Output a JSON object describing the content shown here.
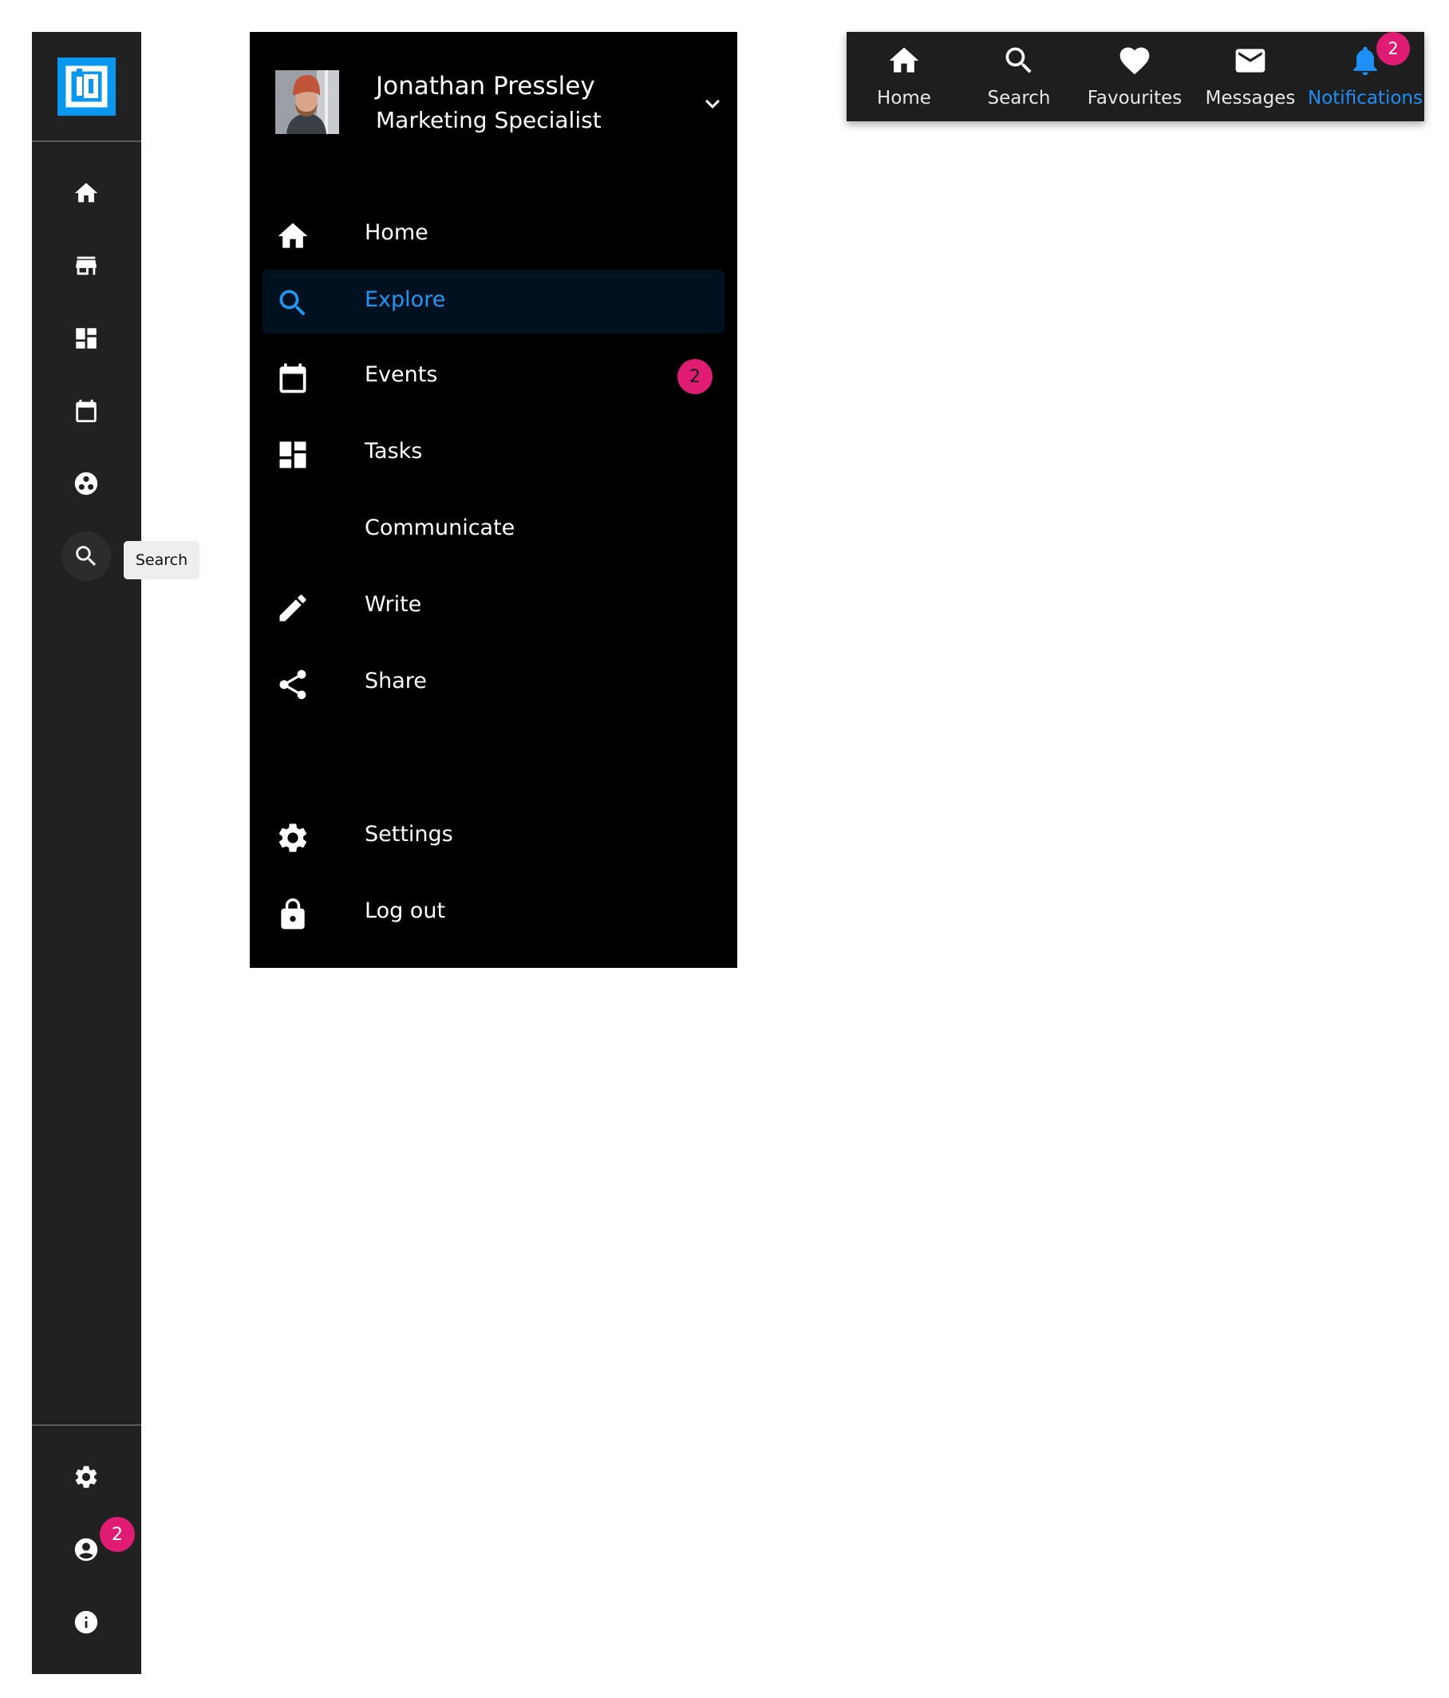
{
  "rail": {
    "logo": "brand-logo",
    "items": [
      {
        "icon": "home-icon"
      },
      {
        "icon": "store-icon"
      },
      {
        "icon": "dashboard-icon"
      },
      {
        "icon": "calendar-icon"
      },
      {
        "icon": "community-icon"
      },
      {
        "icon": "search-icon",
        "active": true
      }
    ],
    "bottom_items": [
      {
        "icon": "gear-icon"
      },
      {
        "icon": "account-icon",
        "badge": "2"
      },
      {
        "icon": "info-icon"
      }
    ],
    "tooltip": "Search"
  },
  "drawer": {
    "user": {
      "name": "Jonathan Pressley",
      "title": "Marketing Specialist"
    },
    "items": [
      {
        "label": "Home",
        "icon": "home-icon"
      },
      {
        "label": "Explore",
        "icon": "search-icon",
        "active": true
      },
      {
        "label": "Events",
        "icon": "calendar-icon",
        "badge": "2"
      },
      {
        "label": "Tasks",
        "icon": "dashboard-icon"
      },
      {
        "label": "Communicate",
        "icon": ""
      },
      {
        "label": "Write",
        "icon": "pencil-icon"
      },
      {
        "label": "Share",
        "icon": "share-icon"
      }
    ],
    "footer_items": [
      {
        "label": "Settings",
        "icon": "gear-icon"
      },
      {
        "label": "Log out",
        "icon": "lock-icon"
      }
    ]
  },
  "bottom_nav": {
    "items": [
      {
        "label": "Home",
        "icon": "home-icon"
      },
      {
        "label": "Search",
        "icon": "search-icon"
      },
      {
        "label": "Favourites",
        "icon": "heart-icon"
      },
      {
        "label": "Messages",
        "icon": "mail-icon"
      },
      {
        "label": "Notifications",
        "icon": "bell-icon",
        "active": true,
        "badge": "2"
      }
    ]
  },
  "colors": {
    "accent": "#2196f3",
    "badge": "#e01b74",
    "rail_bg": "#212121",
    "drawer_bg": "#000000",
    "bottom_bar_bg": "#1e1e1e"
  }
}
